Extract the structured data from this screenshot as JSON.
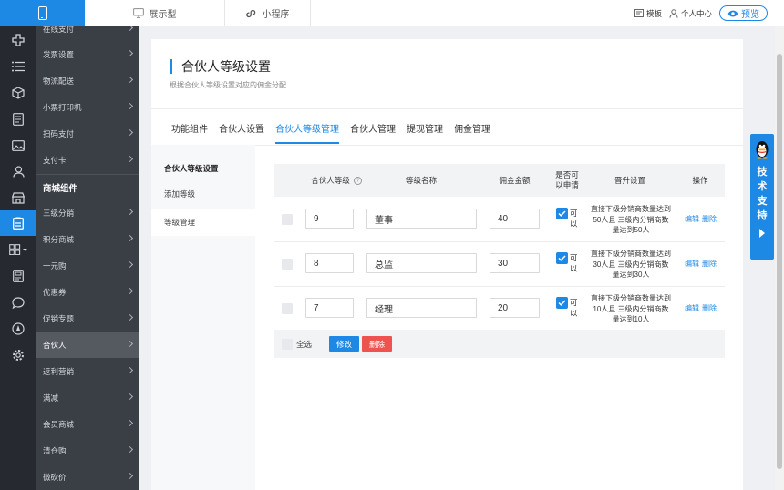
{
  "topbar": {
    "tabs": [
      "展示型",
      "小程序"
    ],
    "template_label": "模板",
    "user_label": "个人中心",
    "preview_label": "预览"
  },
  "submenu": {
    "items_top": [
      "在线支付",
      "发票设置",
      "物流配送",
      "小票打印机",
      "扫码支付",
      "支付卡"
    ],
    "section": "商城组件",
    "items": [
      "三级分销",
      "积分商城",
      "一元购",
      "优惠券",
      "促销专题",
      "合伙人",
      "返利营销",
      "满减",
      "会员商城",
      "清仓购",
      "微砍价"
    ],
    "active": "合伙人"
  },
  "page": {
    "title": "合伙人等级设置",
    "subtitle": "根据合伙人等级设置对应的佣金分配",
    "tabs": [
      "功能组件",
      "合伙人设置",
      "合伙人等级管理",
      "合伙人管理",
      "提现管理",
      "佣金管理"
    ],
    "active_tab": "合伙人等级管理"
  },
  "side_nav": {
    "title": "合伙人等级设置",
    "items": [
      "添加等级",
      "等级管理"
    ]
  },
  "table": {
    "headers": {
      "level": "合伙人等级",
      "help": "?",
      "name": "等级名称",
      "commission": "佣金金额",
      "apply": "是否可以申请",
      "upgrade": "晋升设置",
      "ops": "操作"
    },
    "rows": [
      {
        "level": "9",
        "name": "董事",
        "commission": "40",
        "apply_label": "可以",
        "rule": "直接下级分销商数量达到50人且 三级内分销商数量达到50人",
        "edit": "编辑",
        "delete": "删除"
      },
      {
        "level": "8",
        "name": "总监",
        "commission": "30",
        "apply_label": "可以",
        "rule": "直接下级分销商数量达到30人且 三级内分销商数量达到30人",
        "edit": "编辑",
        "delete": "删除"
      },
      {
        "level": "7",
        "name": "经理",
        "commission": "20",
        "apply_label": "可以",
        "rule": "直接下级分销商数量达到10人且 三级内分销商数量达到10人",
        "edit": "编辑",
        "delete": "删除"
      }
    ],
    "footer": {
      "select_all": "全选",
      "modify": "修改",
      "delete": "删除"
    }
  },
  "support": {
    "label": "技术支持"
  },
  "colors": {
    "accent": "#1e88e5",
    "danger": "#ef5350",
    "sidebar": "#3a3f46",
    "iconbar": "#262a30"
  }
}
